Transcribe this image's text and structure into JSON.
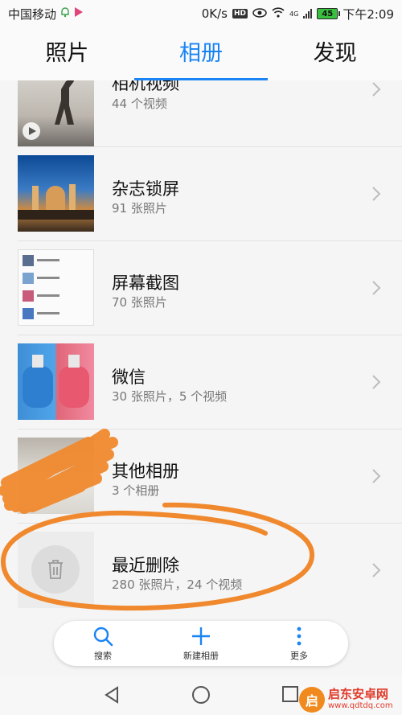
{
  "status_bar": {
    "carrier": "中国移动",
    "speed": "0K/s",
    "hd": "HD",
    "network": "4G",
    "battery": "45",
    "time": "下午2:09"
  },
  "tabs": [
    {
      "label": "照片",
      "active": false
    },
    {
      "label": "相册",
      "active": true
    },
    {
      "label": "发现",
      "active": false
    }
  ],
  "albums": [
    {
      "title": "相机视频",
      "subtitle": "44 个视频"
    },
    {
      "title": "杂志锁屏",
      "subtitle": "91 张照片"
    },
    {
      "title": "屏幕截图",
      "subtitle": "70 张照片"
    },
    {
      "title": "微信",
      "subtitle": "30 张照片，5 个视频"
    },
    {
      "title": "其他相册",
      "subtitle": "3 个相册"
    },
    {
      "title": "最近删除",
      "subtitle": "280 张照片，24 个视频"
    }
  ],
  "toolbar": {
    "search_label": "搜索",
    "new_album_label": "新建相册",
    "more_label": "更多"
  },
  "watermark": {
    "logo": "启",
    "name": "启东安卓网",
    "url": "www.qdtdq.com"
  },
  "colors": {
    "accent": "#1a84f5",
    "annotation": "#f0892e"
  },
  "icons": [
    "search-icon",
    "plus-icon",
    "more-vertical-icon",
    "trash-icon",
    "chevron-right-icon",
    "back-icon",
    "home-icon",
    "recents-icon"
  ]
}
